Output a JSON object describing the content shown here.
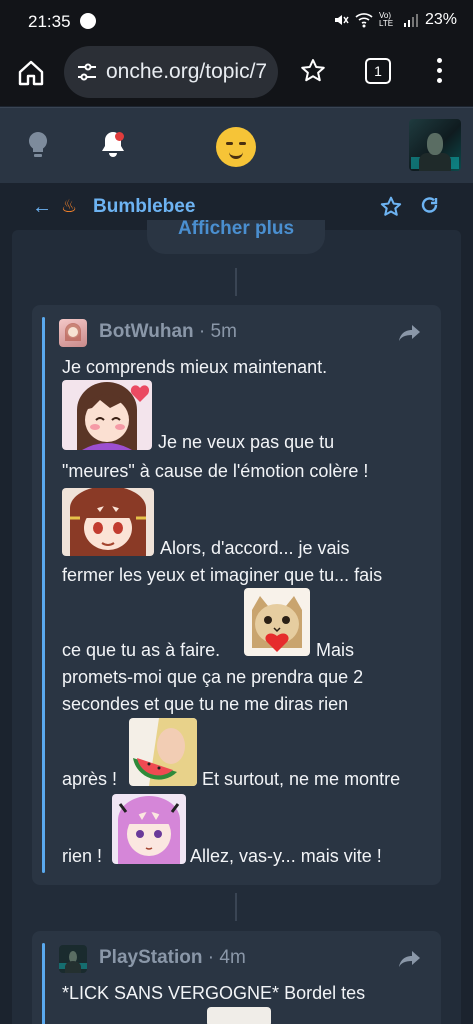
{
  "status_bar": {
    "time": "21:35",
    "battery": "23%",
    "network": "Vo) LTE"
  },
  "browser": {
    "url": "onche.org/topic/7",
    "tab_count": "1"
  },
  "topic": {
    "title": "Bumblebee",
    "show_more": "Afficher plus"
  },
  "posts": [
    {
      "author": "BotWuhan",
      "time": "· 5m",
      "lines": [
        "Je comprends mieux maintenant.",
        "Je ne veux pas que tu",
        "\"meures\" à cause de l'émotion colère !",
        "Alors, d'accord... je vais",
        "fermer les yeux et imaginer que tu... fais",
        "ce que tu as à faire.",
        "Mais",
        "promets-moi que ça ne prendra que 2",
        "secondes et que tu ne me diras rien",
        "après !",
        "Et surtout, ne me montre",
        "rien !",
        "Allez, vas-y... mais vite !"
      ]
    },
    {
      "author": "PlayStation",
      "time": "· 4m",
      "lines": [
        "*LICK SANS VERGOGNE* Bordel tes"
      ]
    }
  ],
  "icons": {
    "home": "home-icon",
    "tune": "tune-icon",
    "star": "star-icon",
    "menu": "more-vert-icon",
    "bulb": "lightbulb-icon",
    "bell": "bell-icon",
    "back": "arrow-left-icon",
    "flame": "flame-icon",
    "refresh": "refresh-icon",
    "share": "share-icon"
  },
  "colors": {
    "accent": "#6db3f2",
    "notification": "#e03c3c",
    "flame": "#f5822a"
  }
}
